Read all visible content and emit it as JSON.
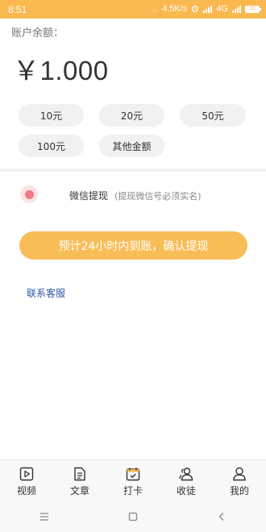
{
  "status_bar": {
    "time": "8:51",
    "dots": "...",
    "net_speed": "4.5K/s",
    "network": "4G",
    "battery": "33"
  },
  "balance": {
    "label": "账户余额：",
    "amount": "￥1.000"
  },
  "amounts": [
    "10元",
    "20元",
    "50元",
    "100元",
    "其他金额"
  ],
  "withdraw_method": {
    "label": "微信提现",
    "note": "(提现微信号必须实名)",
    "selected": true
  },
  "confirm_button": "预计24小时内到账，确认提现",
  "service_link": "联系客服",
  "bottom_nav": {
    "video": "视频",
    "article": "文章",
    "checkin": "打卡",
    "apprentice": "收徒",
    "mine": "我的"
  },
  "colors": {
    "accent": "#f9b94f",
    "radio": "#f07886",
    "link": "#2c58a8"
  }
}
